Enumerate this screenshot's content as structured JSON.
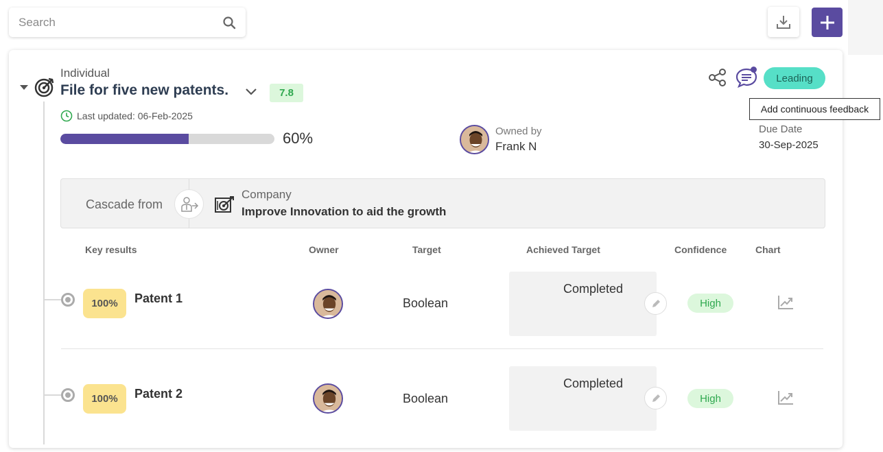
{
  "search": {
    "placeholder": "Search"
  },
  "objective": {
    "type": "Individual",
    "title": "File for five new patents.",
    "score": "7.8",
    "last_updated": "Last updated: 06-Feb-2025",
    "progress_pct_label": "60%",
    "progress_fraction": 0.6,
    "owned_by_label": "Owned by",
    "owner_name": "Frank N",
    "status": "Leading",
    "due_label": "Due Date",
    "due_value": "30-Sep-2025",
    "tooltip": "Add continuous feedback"
  },
  "cascade": {
    "label": "Cascade from",
    "parent_type": "Company",
    "parent_title": "Improve Innovation to aid the growth"
  },
  "columns": {
    "key_results": "Key results",
    "owner": "Owner",
    "target": "Target",
    "achieved": "Achieved Target",
    "confidence": "Confidence",
    "chart": "Chart"
  },
  "key_results": [
    {
      "pct": "100%",
      "name": "Patent 1",
      "target": "Boolean",
      "achieved": "Completed",
      "confidence": "High"
    },
    {
      "pct": "100%",
      "name": "Patent 2",
      "target": "Boolean",
      "achieved": "Completed",
      "confidence": "High"
    }
  ],
  "colors": {
    "accent": "#5a4ba0",
    "leading": "#56dfc7",
    "high": "#dcf7dc",
    "pct_badge": "#fbe38f"
  }
}
